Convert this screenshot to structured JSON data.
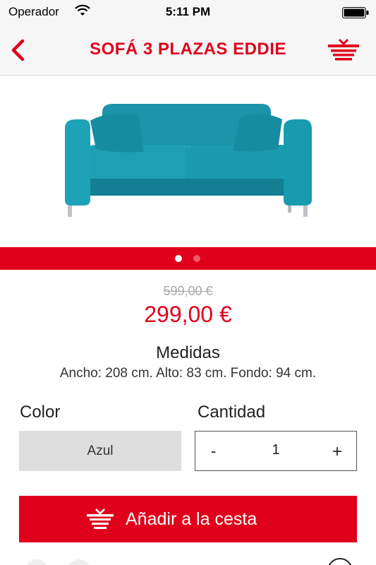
{
  "status_bar": {
    "carrier": "Operador",
    "time": "5:11 PM"
  },
  "nav": {
    "title": "SOFÁ 3 PLAZAS EDDIE",
    "back_icon": "chevron-left-icon",
    "cart_icon": "shopping-basket-icon"
  },
  "gallery": {
    "image": "teal-sofa-photo",
    "page_count": 2,
    "active_page": 1
  },
  "pricing": {
    "old_price": "599,00 €",
    "price": "299,00 €"
  },
  "dimensions": {
    "title": "Medidas",
    "text": "Ancho: 208 cm. Alto: 83 cm. Fondo: 94 cm."
  },
  "options": {
    "color_label": "Color",
    "color_value": "Azul",
    "quantity_label": "Cantidad",
    "minus": "-",
    "quantity": "1",
    "plus": "+"
  },
  "add_to_cart": {
    "label": "Añadir a la cesta",
    "icon": "shopping-basket-icon"
  },
  "colors": {
    "brand_red": "#e0001b",
    "sofa_teal": "#1a9bb0",
    "select_grey": "#dedede"
  }
}
